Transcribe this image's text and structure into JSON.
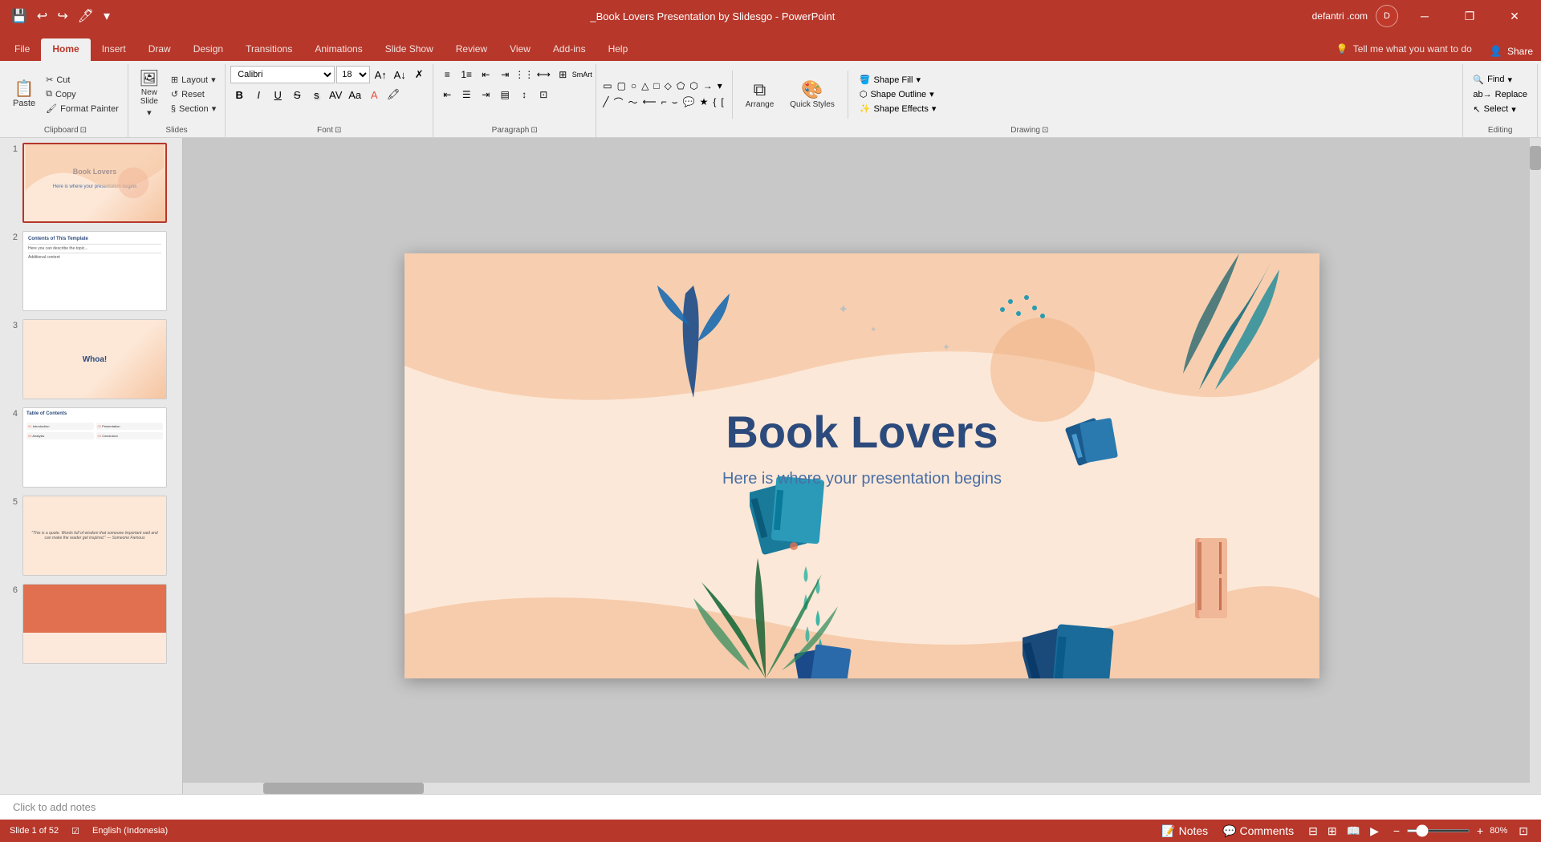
{
  "window": {
    "title": "_Book Lovers Presentation by Slidesgo - PowerPoint",
    "user": "defantri .com",
    "user_initial": "D"
  },
  "quick_access": {
    "save": "💾",
    "undo": "↩",
    "redo": "↪",
    "customize": "🖊",
    "dropdown": "▾"
  },
  "win_controls": {
    "minimize": "─",
    "restore": "❐",
    "close": "✕"
  },
  "tabs": [
    {
      "label": "File",
      "active": false
    },
    {
      "label": "Home",
      "active": true
    },
    {
      "label": "Insert",
      "active": false
    },
    {
      "label": "Draw",
      "active": false
    },
    {
      "label": "Design",
      "active": false
    },
    {
      "label": "Transitions",
      "active": false
    },
    {
      "label": "Animations",
      "active": false
    },
    {
      "label": "Slide Show",
      "active": false
    },
    {
      "label": "Review",
      "active": false
    },
    {
      "label": "View",
      "active": false
    },
    {
      "label": "Add-ins",
      "active": false
    },
    {
      "label": "Help",
      "active": false
    }
  ],
  "tell_me": {
    "icon": "💡",
    "placeholder": "Tell me what you want to do"
  },
  "ribbon": {
    "clipboard_group": {
      "label": "Clipboard",
      "paste_label": "Paste",
      "cut_label": "Cut",
      "copy_label": "Copy",
      "format_painter_label": "Format Painter"
    },
    "slides_group": {
      "label": "Slides",
      "new_slide_label": "New\nSlide",
      "layout_label": "Layout",
      "reset_label": "Reset",
      "section_label": "Section"
    },
    "font_group": {
      "label": "Font",
      "font_name": "Calibri",
      "font_size": "18",
      "bold": "B",
      "italic": "I",
      "underline": "U",
      "strikethrough": "S",
      "shadow": "s",
      "char_spacing": "AV",
      "change_case": "Aa",
      "font_color": "A",
      "increase_size": "A↑",
      "decrease_size": "A↓",
      "clear_format": "✗"
    },
    "paragraph_group": {
      "label": "Paragraph",
      "bullets": "≡",
      "numbering": "1≡",
      "decrease_indent": "←≡",
      "increase_indent": "→≡",
      "columns": "⫸",
      "align_left": "≡",
      "align_center": "≡",
      "align_right": "≡",
      "justify": "≡",
      "line_spacing": "↕",
      "text_direction": "⇔",
      "smart_art": "⊞",
      "convert_to_smartart": "SmArt"
    },
    "drawing_group": {
      "label": "Drawing",
      "arrange_label": "Arrange",
      "quick_styles_label": "Quick\nStyles",
      "shape_fill_label": "Shape Fill",
      "shape_outline_label": "Shape Outline",
      "shape_effects_label": "Shape Effects"
    },
    "editing_group": {
      "label": "Editing",
      "find_label": "Find",
      "replace_label": "Replace",
      "select_label": "Select"
    }
  },
  "slide_panel": {
    "slides": [
      {
        "num": "1",
        "type": "title",
        "active": true
      },
      {
        "num": "2",
        "type": "content"
      },
      {
        "num": "3",
        "type": "whoa"
      },
      {
        "num": "4",
        "type": "table"
      },
      {
        "num": "5",
        "type": "quote"
      },
      {
        "num": "6",
        "type": "accent"
      }
    ]
  },
  "main_slide": {
    "title": "Book Lovers",
    "subtitle": "Here is where your presentation begins"
  },
  "notes_bar": {
    "placeholder": "Click to add notes"
  },
  "status_bar": {
    "slide_info": "Slide 1 of 52",
    "language": "English (Indonesia)",
    "notes_label": "Notes",
    "comments_label": "Comments",
    "zoom_percent": "80%",
    "zoom_value": "80"
  }
}
